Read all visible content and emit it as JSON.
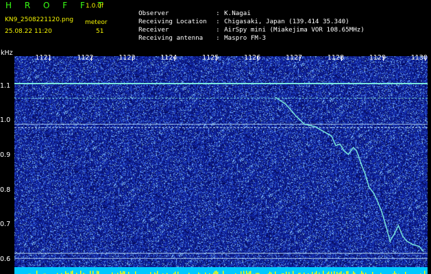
{
  "header": {
    "brand": "H R O F F T",
    "version": "1.0.0f",
    "filename": "KN9_2508221120.png",
    "meteor_label": "meteor",
    "meteor_count": "51",
    "datetime": "25.08.22 11:20"
  },
  "meta": [
    {
      "label": "Observer",
      "sep": ":",
      "value": "K.Nagai"
    },
    {
      "label": "Receiving Location",
      "sep": ":",
      "value": "Chigasaki, Japan (139.414 35.340)"
    },
    {
      "label": "Receiver",
      "sep": ":",
      "value": "AirSpy mini (Miakejima VOR 108.65MHz)"
    },
    {
      "label": "Receiving antenna",
      "sep": ":",
      "value": "Maspro FM-3"
    }
  ],
  "colors": {
    "background": "#000000",
    "plot_background": "#0c1a8a",
    "noise_bright": "#8fd7ff",
    "trace": "#7ff0e0",
    "header_brand": "#39ff14",
    "header_yellow": "#f5f500",
    "bottom_bar": "#00c8ff",
    "bottom_spikes": "#ffff00"
  },
  "chart_data": {
    "type": "heatmap",
    "y_unit": "kHz",
    "x_ticks": [
      "1121",
      "1122",
      "1123",
      "1124",
      "1125",
      "1126",
      "1127",
      "1128",
      "1129",
      "1130"
    ],
    "x_tick_values": [
      1121,
      1122,
      1123,
      1124,
      1125,
      1126,
      1127,
      1128,
      1129,
      1130
    ],
    "y_ticks": [
      "1.1",
      "1.0",
      "0.9",
      "0.8",
      "0.7",
      "0.6"
    ],
    "y_tick_values": [
      1.1,
      1.0,
      0.9,
      0.8,
      0.7,
      0.6
    ],
    "xlim": [
      1120.3,
      1130.2
    ],
    "ylim": [
      0.58,
      1.188
    ],
    "horizontal_lines_khz": [
      1.109,
      1.067,
      0.992,
      0.982,
      0.62,
      0.605
    ],
    "doppler_trace": [
      {
        "x": 1126.55,
        "y": 1.07
      },
      {
        "x": 1126.8,
        "y": 1.05
      },
      {
        "x": 1127.05,
        "y": 1.015
      },
      {
        "x": 1127.25,
        "y": 0.992
      },
      {
        "x": 1127.5,
        "y": 0.985
      },
      {
        "x": 1127.9,
        "y": 0.958
      },
      {
        "x": 1128.0,
        "y": 0.93
      },
      {
        "x": 1128.1,
        "y": 0.935
      },
      {
        "x": 1128.2,
        "y": 0.915
      },
      {
        "x": 1128.3,
        "y": 0.905
      },
      {
        "x": 1128.42,
        "y": 0.925
      },
      {
        "x": 1128.5,
        "y": 0.915
      },
      {
        "x": 1128.6,
        "y": 0.88
      },
      {
        "x": 1128.7,
        "y": 0.85
      },
      {
        "x": 1128.8,
        "y": 0.81
      },
      {
        "x": 1128.9,
        "y": 0.795
      },
      {
        "x": 1129.0,
        "y": 0.77
      },
      {
        "x": 1129.1,
        "y": 0.74
      },
      {
        "x": 1129.2,
        "y": 0.7
      },
      {
        "x": 1129.3,
        "y": 0.655
      },
      {
        "x": 1129.4,
        "y": 0.675
      },
      {
        "x": 1129.5,
        "y": 0.7
      },
      {
        "x": 1129.6,
        "y": 0.67
      },
      {
        "x": 1129.7,
        "y": 0.655
      },
      {
        "x": 1129.85,
        "y": 0.645
      },
      {
        "x": 1130.0,
        "y": 0.64
      },
      {
        "x": 1130.1,
        "y": 0.625
      }
    ],
    "grid": false
  }
}
